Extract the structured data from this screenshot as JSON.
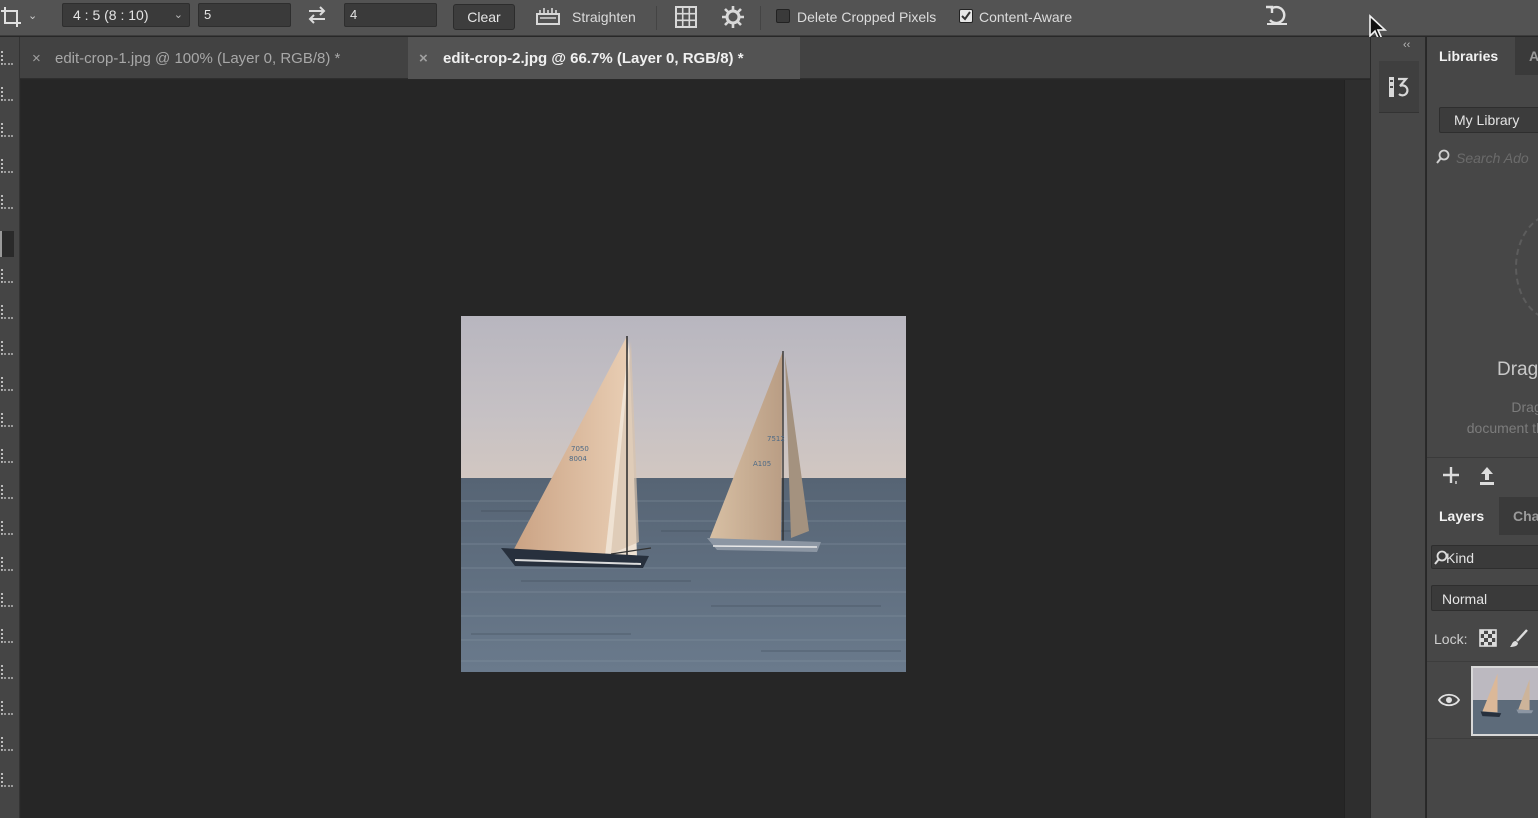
{
  "options_bar": {
    "tool_icon": "crop-tool-icon",
    "ratio_preset": "4 : 5 (8 : 10)",
    "width_value": "5",
    "height_value": "4",
    "clear_label": "Clear",
    "straighten_label": "Straighten",
    "delete_cropped_label": "Delete Cropped Pixels",
    "delete_cropped_checked": false,
    "content_aware_label": "Content-Aware",
    "content_aware_checked": true
  },
  "document_tabs": [
    {
      "title": "edit-crop-1.jpg @ 100% (Layer 0, RGB/8) *",
      "active": false,
      "close": "×"
    },
    {
      "title": "edit-crop-2.jpg @ 66.7% (Layer 0, RGB/8) *",
      "active": true,
      "close": "×"
    }
  ],
  "libraries_panel": {
    "tabs": [
      "Libraries",
      "A"
    ],
    "library_name": "My Library",
    "search_placeholder": "Search Ado",
    "drag_title": "Drag",
    "drag_text": "Drag and document the '+' butt"
  },
  "layers_panel": {
    "tabs": [
      "Layers",
      "Cha"
    ],
    "kind_label": "Kind",
    "blend_mode": "Normal",
    "lock_label": "Lock:",
    "layer_visible": true
  },
  "colors": {
    "ui_bg": "#535353",
    "canvas_bg": "#262626",
    "panel_bg": "#474747",
    "active_tab": "#535353"
  }
}
